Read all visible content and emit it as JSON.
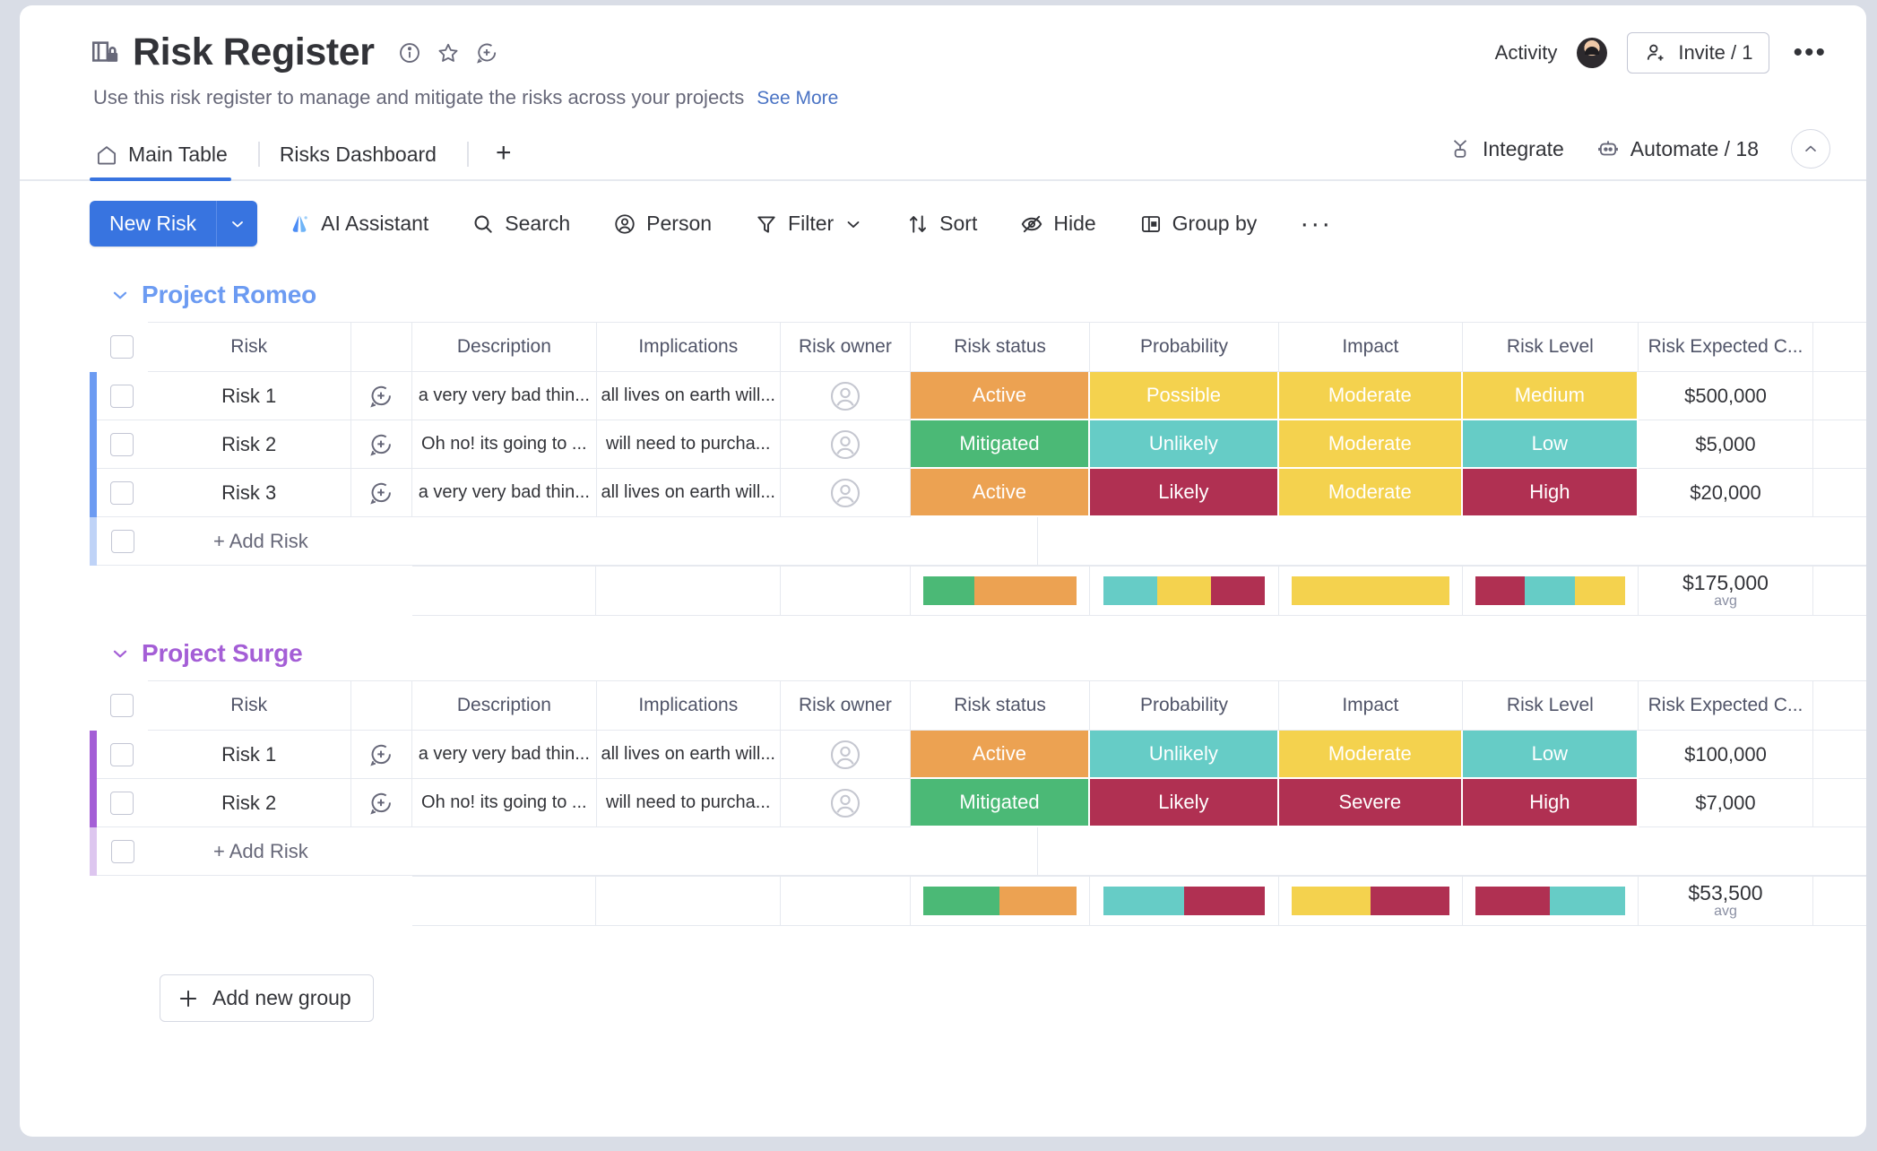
{
  "header": {
    "title": "Risk Register",
    "subtitle": "Use this risk register to manage and mitigate the risks across your projects",
    "see_more": "See More",
    "activity_label": "Activity",
    "invite_label": "Invite / 1",
    "icons": {
      "info": "info-icon",
      "star": "star-icon",
      "add_update": "add-update-icon"
    }
  },
  "tabs": {
    "items": [
      {
        "label": "Main Table",
        "icon": "home-icon",
        "active": true
      },
      {
        "label": "Risks Dashboard",
        "icon": "",
        "active": false
      }
    ],
    "add_tab": "+",
    "right": [
      {
        "label": "Integrate",
        "icon": "integrate-icon"
      },
      {
        "label": "Automate / 18",
        "icon": "robot-icon"
      }
    ]
  },
  "toolbar": {
    "new_item_label": "New Risk",
    "buttons": [
      {
        "label": "AI Assistant",
        "icon": "ai-sparkle-icon"
      },
      {
        "label": "Search",
        "icon": "search-icon"
      },
      {
        "label": "Person",
        "icon": "person-icon"
      },
      {
        "label": "Filter",
        "icon": "filter-icon",
        "caret": true
      },
      {
        "label": "Sort",
        "icon": "sort-icon"
      },
      {
        "label": "Hide",
        "icon": "eye-off-icon"
      },
      {
        "label": "Group by",
        "icon": "group-by-icon"
      }
    ],
    "more_label": "···"
  },
  "columns": [
    "Risk",
    "Description",
    "Implications",
    "Risk owner",
    "Risk status",
    "Probability",
    "Impact",
    "Risk Level",
    "Risk Expected C..."
  ],
  "add_row_label": "+ Add Risk",
  "add_group_label": "Add new group",
  "colors": {
    "accent_blue": "#3874e0",
    "group_romeo": "#6c9bf2",
    "group_surge": "#a45ed6",
    "orange": "#eca252",
    "green": "#4bb976",
    "yellow": "#f4d24e",
    "teal": "#66ccc6",
    "crimson": "#b03052"
  },
  "groups": [
    {
      "name": "Project Romeo",
      "color": "#6c9bf2",
      "rows": [
        {
          "risk": "Risk 1",
          "description": "a very very bad thin...",
          "implications": "all lives on earth will...",
          "status": {
            "label": "Active",
            "color": "#eca252"
          },
          "probability": {
            "label": "Possible",
            "color": "#f4d24e"
          },
          "impact": {
            "label": "Moderate",
            "color": "#f4d24e"
          },
          "level": {
            "label": "Medium",
            "color": "#f4d24e"
          },
          "cost": "$500,000"
        },
        {
          "risk": "Risk 2",
          "description": "Oh no! its going to ...",
          "implications": "will need to purcha...",
          "status": {
            "label": "Mitigated",
            "color": "#4bb976"
          },
          "probability": {
            "label": "Unlikely",
            "color": "#66ccc6"
          },
          "impact": {
            "label": "Moderate",
            "color": "#f4d24e"
          },
          "level": {
            "label": "Low",
            "color": "#66ccc6"
          },
          "cost": "$5,000"
        },
        {
          "risk": "Risk 3",
          "description": "a very very bad thin...",
          "implications": "all lives on earth will...",
          "status": {
            "label": "Active",
            "color": "#eca252"
          },
          "probability": {
            "label": "Likely",
            "color": "#b03052"
          },
          "impact": {
            "label": "Moderate",
            "color": "#f4d24e"
          },
          "level": {
            "label": "High",
            "color": "#b03052"
          },
          "cost": "$20,000"
        }
      ],
      "summary": {
        "status_bar": [
          {
            "color": "#4bb976",
            "pct": 33.3
          },
          {
            "color": "#eca252",
            "pct": 66.7
          }
        ],
        "probability_bar": [
          {
            "color": "#66ccc6",
            "pct": 33.3
          },
          {
            "color": "#f4d24e",
            "pct": 33.4
          },
          {
            "color": "#b03052",
            "pct": 33.3
          }
        ],
        "impact_bar": [
          {
            "color": "#f4d24e",
            "pct": 100
          }
        ],
        "level_bar": [
          {
            "color": "#b03052",
            "pct": 33.3
          },
          {
            "color": "#66ccc6",
            "pct": 33.4
          },
          {
            "color": "#f4d24e",
            "pct": 33.3
          }
        ],
        "cost_value": "$175,000",
        "cost_unit": "avg"
      }
    },
    {
      "name": "Project Surge",
      "color": "#a45ed6",
      "rows": [
        {
          "risk": "Risk 1",
          "description": "a very very bad thin...",
          "implications": "all lives on earth will...",
          "status": {
            "label": "Active",
            "color": "#eca252"
          },
          "probability": {
            "label": "Unlikely",
            "color": "#66ccc6"
          },
          "impact": {
            "label": "Moderate",
            "color": "#f4d24e"
          },
          "level": {
            "label": "Low",
            "color": "#66ccc6"
          },
          "cost": "$100,000"
        },
        {
          "risk": "Risk 2",
          "description": "Oh no! its going to ...",
          "implications": "will need to purcha...",
          "status": {
            "label": "Mitigated",
            "color": "#4bb976"
          },
          "probability": {
            "label": "Likely",
            "color": "#b03052"
          },
          "impact": {
            "label": "Severe",
            "color": "#b03052"
          },
          "level": {
            "label": "High",
            "color": "#b03052"
          },
          "cost": "$7,000"
        }
      ],
      "summary": {
        "status_bar": [
          {
            "color": "#4bb976",
            "pct": 50
          },
          {
            "color": "#eca252",
            "pct": 50
          }
        ],
        "probability_bar": [
          {
            "color": "#66ccc6",
            "pct": 50
          },
          {
            "color": "#b03052",
            "pct": 50
          }
        ],
        "impact_bar": [
          {
            "color": "#f4d24e",
            "pct": 50
          },
          {
            "color": "#b03052",
            "pct": 50
          }
        ],
        "level_bar": [
          {
            "color": "#b03052",
            "pct": 50
          },
          {
            "color": "#66ccc6",
            "pct": 50
          }
        ],
        "cost_value": "$53,500",
        "cost_unit": "avg"
      }
    }
  ]
}
